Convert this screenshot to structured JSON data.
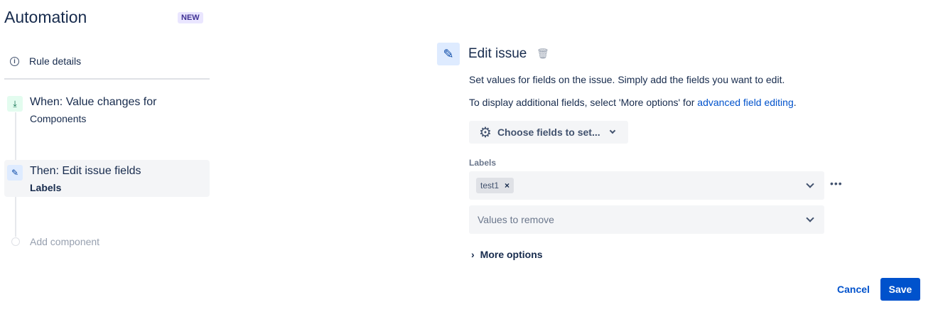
{
  "sidebar": {
    "title": "Automation",
    "badge": "NEW",
    "rule_details": "Rule details",
    "trigger": {
      "title": "When: Value changes for",
      "subtitle": "Components"
    },
    "action": {
      "title": "Then: Edit issue fields",
      "subtitle": "Labels"
    },
    "add_component": "Add component"
  },
  "panel": {
    "title": "Edit issue",
    "desc1": "Set values for fields on the issue. Simply add the fields you want to edit.",
    "desc2": "To display additional fields, select 'More options' for ",
    "desc2_link": "advanced field editing",
    "desc2_end": ".",
    "choose_fields": "Choose fields to set...",
    "labels_label": "Labels",
    "tag": "test1",
    "tag_remove": "×",
    "remove_placeholder": "Values to remove",
    "more_options": "More options",
    "more_menu": "•••"
  },
  "footer": {
    "cancel": "Cancel",
    "save": "Save"
  }
}
